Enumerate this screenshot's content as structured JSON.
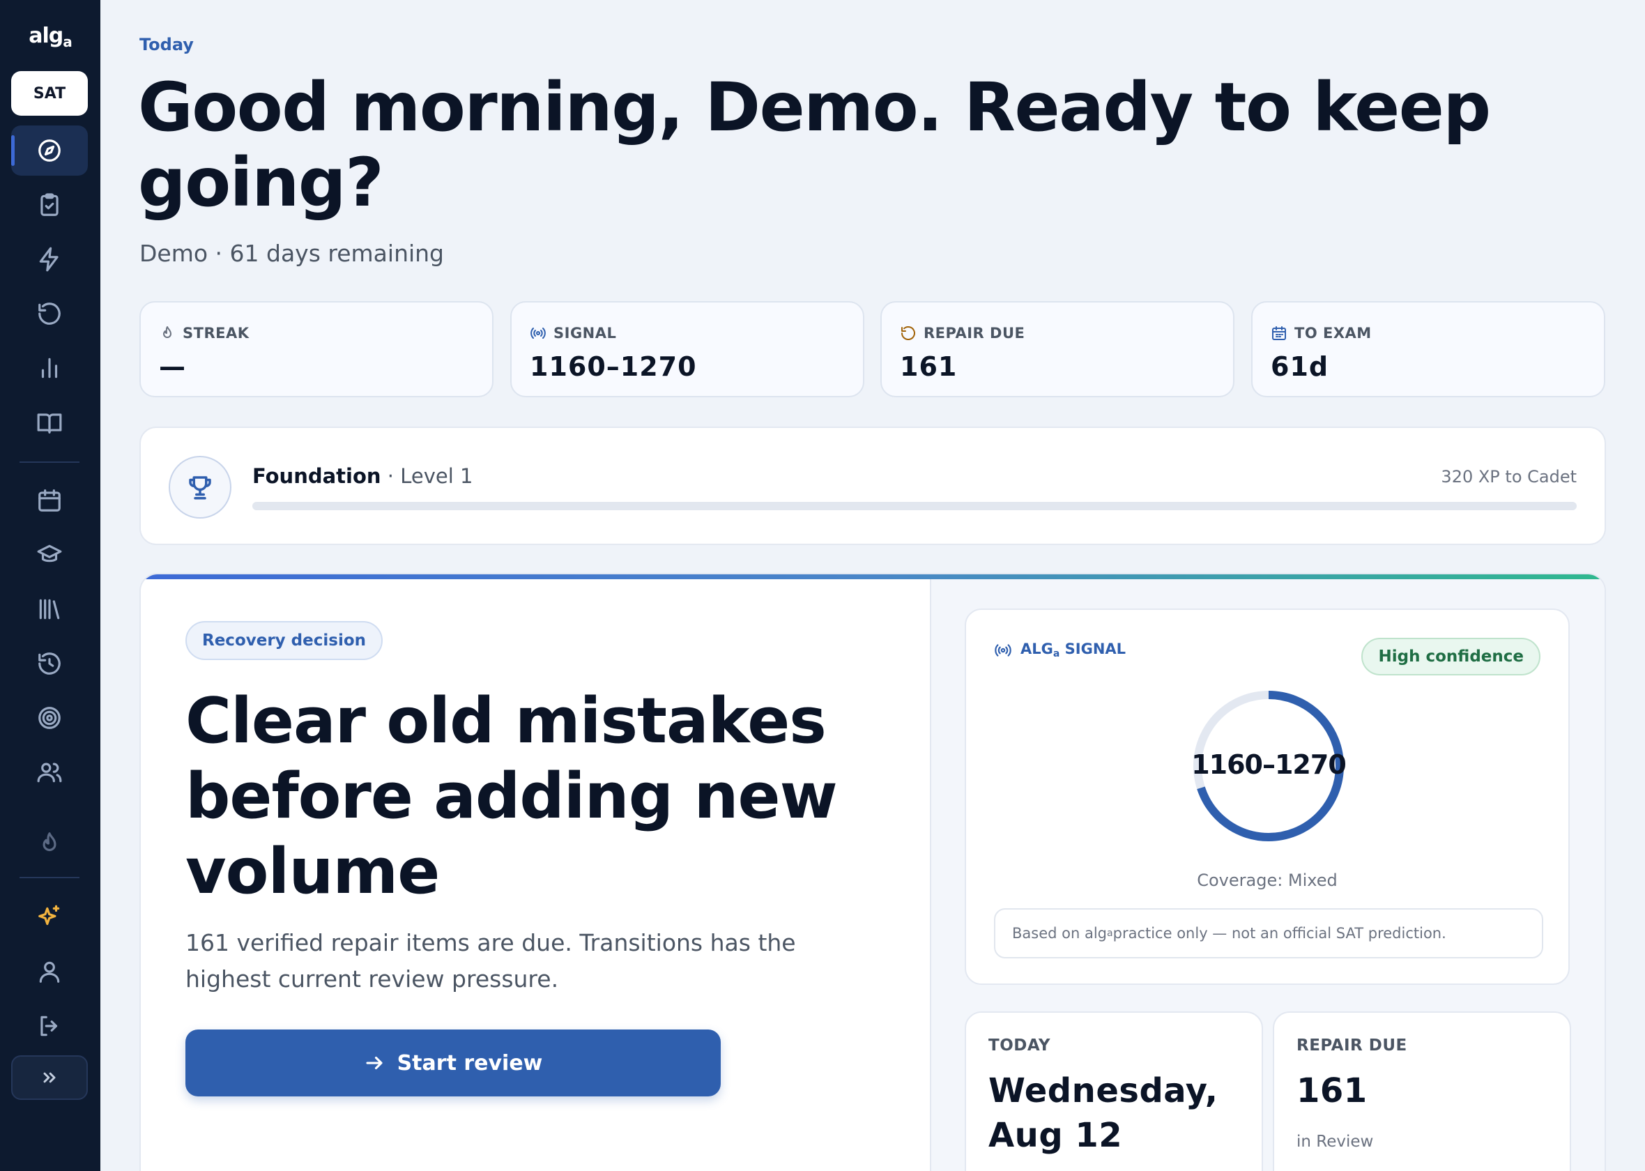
{
  "sidebar": {
    "logo": "alg",
    "logo_sub": "a",
    "exam": "SAT"
  },
  "header": {
    "eyebrow": "Today",
    "greeting": "Good morning, Demo. Ready to keep going?",
    "subtitle": "Demo · 61 days remaining"
  },
  "stats": [
    {
      "label": "STREAK",
      "value": "—",
      "icon": "flame-icon"
    },
    {
      "label": "SIGNAL",
      "value": "1160–1270",
      "icon": "signal-icon"
    },
    {
      "label": "REPAIR DUE",
      "value": "161",
      "icon": "refresh-icon"
    },
    {
      "label": "TO EXAM",
      "value": "61d",
      "icon": "calendar-icon"
    }
  ],
  "level": {
    "tier": "Foundation",
    "level_text": "· Level 1",
    "xp_note": "320 XP to Cadet",
    "progress": 0
  },
  "decision": {
    "tag": "Recovery decision",
    "title": "Clear old mistakes before adding new volume",
    "body": "161 verified repair items are due. Transitions has the highest current review pressure.",
    "cta": "Start review"
  },
  "signal": {
    "label_main": "ALG",
    "label_sub": "a",
    "label_tail": " SIGNAL",
    "confidence": "High confidence",
    "range": "1160–1270",
    "ring_fill": 0.7,
    "coverage": "Coverage: Mixed",
    "disclaimer_pre": "Based on alg",
    "disclaimer_sub": "a",
    "disclaimer_post": " practice only — not an official SAT prediction."
  },
  "today_card": {
    "label": "TODAY",
    "value": "Wednesday, Aug 12"
  },
  "repair_card": {
    "label": "REPAIR DUE",
    "value": "161",
    "sub": "in Review"
  },
  "colors": {
    "sidebar_bg": "#0d1a2f",
    "accent": "#2f5fae",
    "success": "#1f6e44",
    "page_bg": "#eff3f9"
  }
}
